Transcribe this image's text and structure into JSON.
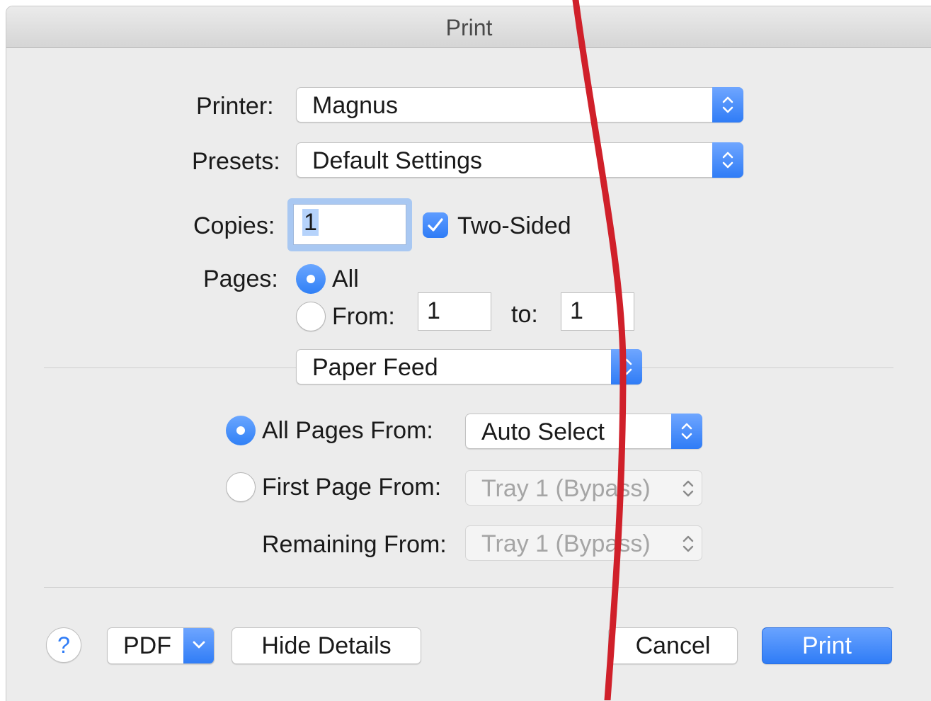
{
  "window": {
    "title": "Print"
  },
  "printer": {
    "label": "Printer:",
    "value": "Magnus"
  },
  "presets": {
    "label": "Presets:",
    "value": "Default Settings"
  },
  "copies": {
    "label": "Copies:",
    "value": "1",
    "two_sided_label": "Two-Sided",
    "two_sided_checked": true
  },
  "pages": {
    "label": "Pages:",
    "all_label": "All",
    "from_label": "From:",
    "from_value": "1",
    "to_label": "to:",
    "to_value": "1",
    "selected": "All"
  },
  "section_popup": {
    "value": "Paper Feed"
  },
  "paper_feed": {
    "all_pages_from_label": "All Pages From:",
    "all_pages_from_value": "Auto Select",
    "first_page_from_label": "First Page From:",
    "first_page_from_value": "Tray 1 (Bypass)",
    "remaining_from_label": "Remaining From:",
    "remaining_from_value": "Tray 1 (Bypass)",
    "selected": "All Pages From"
  },
  "footer": {
    "help_label": "?",
    "pdf_label": "PDF",
    "hide_details_label": "Hide Details",
    "cancel_label": "Cancel",
    "print_label": "Print"
  },
  "colors": {
    "accent": "#2f7cf6",
    "annotation_line": "#d0202a",
    "window_bg": "#ececec"
  },
  "icons": [
    "up-down-chevron-icon",
    "checkmark-icon",
    "chevron-down-icon",
    "question-mark-icon"
  ]
}
